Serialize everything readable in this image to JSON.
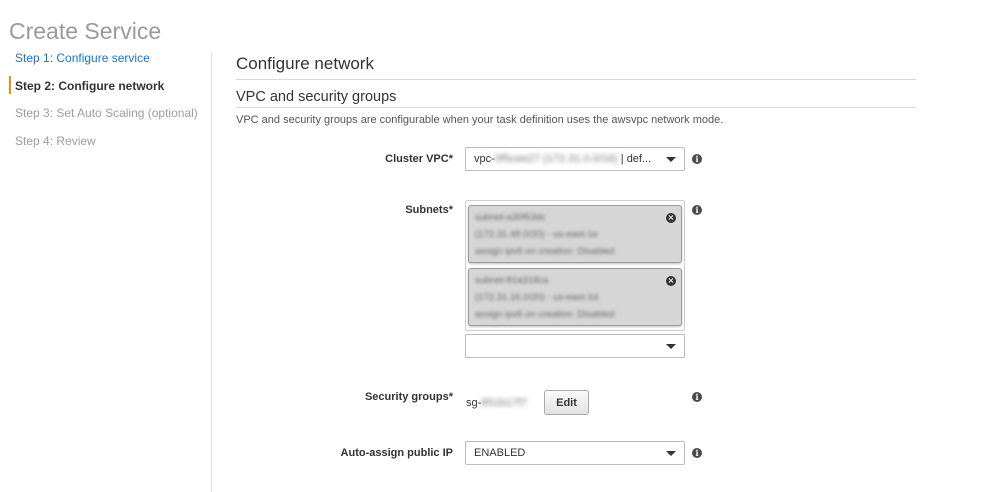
{
  "page": {
    "title": "Create Service"
  },
  "steps": [
    {
      "label": "Step 1: Configure service",
      "state": "completed"
    },
    {
      "label": "Step 2: Configure network",
      "state": "active"
    },
    {
      "label": "Step 3: Set Auto Scaling (optional)",
      "state": "pending"
    },
    {
      "label": "Step 4: Review",
      "state": "pending"
    }
  ],
  "main": {
    "section_title": "Configure network",
    "subsection_title": "VPC and security groups",
    "help_text": "VPC and security groups are configurable when your task definition uses the awsvpc network mode."
  },
  "form": {
    "cluster_vpc": {
      "label": "Cluster VPC*",
      "value_prefix": "vpc-",
      "value_redacted": "0f5cee27 (172.31.0.0/16)",
      "value_suffix": " | def..."
    },
    "subnets": {
      "label": "Subnets*",
      "selected": [
        {
          "line1": "subnet-a30f63dc",
          "line2": "(172.31.48.0/20) - us-east-1e",
          "line3": "assign ipv6 on creation: Disabled"
        },
        {
          "line1": "subnet-81a318ca",
          "line2": "(172.31.16.0/20) - us-east-1d",
          "line3": "assign ipv6 on creation: Disabled"
        }
      ],
      "add_value": ""
    },
    "security_groups": {
      "label": "Security groups*",
      "value_prefix": "sg-",
      "value_redacted": "851b17f7",
      "edit_label": "Edit"
    },
    "auto_assign_ip": {
      "label": "Auto-assign public IP",
      "value": "ENABLED"
    }
  },
  "icons": {
    "info": "info-icon",
    "remove": "close-circle-icon",
    "dropdown": "caret-down-icon"
  },
  "colors": {
    "active_step_marker": "#e8901d",
    "link": "#1f73b7",
    "token_bg": "#d6d6d6"
  }
}
